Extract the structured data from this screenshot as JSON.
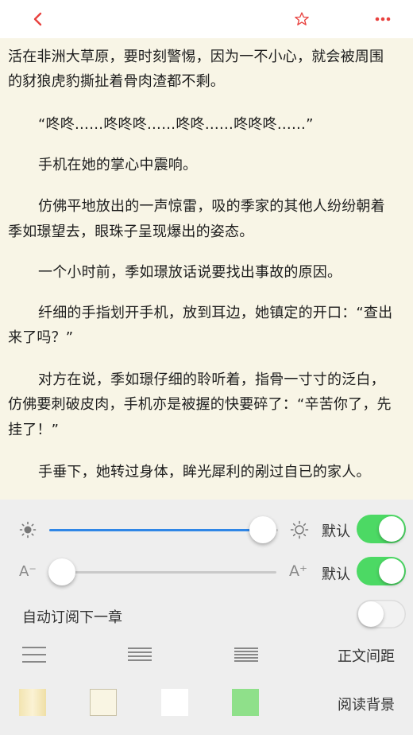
{
  "colors": {
    "accent_red": "#e8413e",
    "page_bg": "#f8f5e6",
    "panel_bg": "#eeeeee",
    "slider_blue": "#2f86e6",
    "toggle_green": "#4cd964"
  },
  "toolbar": {
    "back_icon": "chevron-left-icon",
    "favorite_icon": "star-outline-icon",
    "more_icon": "more-dots-icon"
  },
  "content": {
    "paragraphs": [
      "活在非洲大草原，要时刻警惕，因为一不小心，就会被周围",
      "的豺狼虎豹撕扯着骨肉渣都不剩。",
      "“咚咚……咚咚咚……咚咚……咚咚咚……”",
      "手机在她的掌心中震响。",
      "仿佛平地放出的一声惊雷，吸的季家的其他人纷纷朝着",
      "季如璟望去，眼珠子呈现爆出的姿态。",
      "一个小时前，季如璟放话说要找出事故的原因。",
      "纤细的手指划开手机，放到耳边，她镇定的开口：“查出",
      "来了吗？”",
      "对方在说，季如璟仔细的聆听着，指骨一寸寸的泛白，",
      "仿佛要刺破皮肉，手机亦是被握的快要碎了：“辛苦你了，先",
      "挂了！”",
      "手垂下，她转过身体，眸光犀利的剐过自已的家人。"
    ]
  },
  "settings": {
    "brightness": {
      "label": "默认",
      "value": 0.92,
      "default_on": true
    },
    "font_size": {
      "small_label": "A⁻",
      "large_label": "A⁺",
      "label": "默认",
      "value": 0.05,
      "default_on": true
    },
    "auto_subscribe": {
      "label": "自动订阅下一章",
      "on": false
    },
    "line_spacing": {
      "label": "正文间距",
      "options": [
        "loose",
        "medium",
        "tight"
      ]
    },
    "background": {
      "label": "阅读背景",
      "swatches": [
        "#f3e6b8",
        "#f9f5e3",
        "#ffffff",
        "#8fe08a"
      ]
    }
  }
}
